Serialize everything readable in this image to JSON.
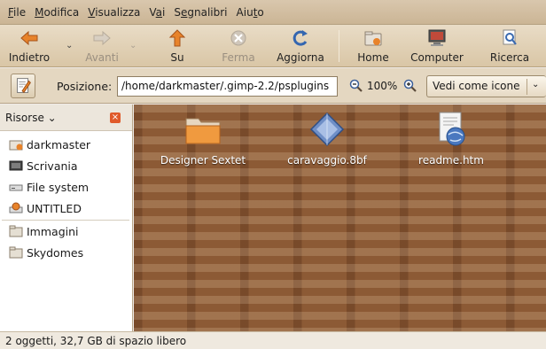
{
  "menubar": {
    "items": [
      {
        "u": "F",
        "rest": "ile"
      },
      {
        "u": "M",
        "rest": "odifica"
      },
      {
        "u": "V",
        "rest": "isualizza"
      },
      {
        "pre": "V",
        "u": "a",
        "rest": "i"
      },
      {
        "pre": "S",
        "u": "e",
        "rest": "gnalibri"
      },
      {
        "pre": "Aiu",
        "u": "t",
        "rest": "o"
      }
    ]
  },
  "toolbar": {
    "back": "Indietro",
    "forward": "Avanti",
    "up": "Su",
    "stop": "Ferma",
    "reload": "Aggiorna",
    "home": "Home",
    "computer": "Computer",
    "search": "Ricerca"
  },
  "location": {
    "label": "Posizione:",
    "path": "/home/darkmaster/.gimp-2.2/psplugins",
    "zoom": "100%",
    "view_mode": "Vedi come icone"
  },
  "sidebar": {
    "title": "Risorse ⌄",
    "items": [
      {
        "label": "darkmaster",
        "icon": "home-folder-icon"
      },
      {
        "label": "Scrivania",
        "icon": "desktop-icon"
      },
      {
        "label": "File system",
        "icon": "drive-icon"
      },
      {
        "label": "UNTITLED",
        "icon": "cdrom-icon"
      },
      {
        "label": "Immagini",
        "icon": "folder-icon"
      },
      {
        "label": "Skydomes",
        "icon": "folder-icon"
      }
    ]
  },
  "files": [
    {
      "name": "Designer Sextet",
      "icon": "folder-icon"
    },
    {
      "name": "caravaggio.8bf",
      "icon": "plugin-file-icon"
    },
    {
      "name": "readme.htm",
      "icon": "html-file-icon"
    }
  ],
  "status": "2 oggetti, 32,7 GB di spazio libero",
  "colors": {
    "accent_orange": "#e8832a",
    "content_bg": "#8c5a35",
    "toolbar_bg": "#d9c6a6"
  }
}
